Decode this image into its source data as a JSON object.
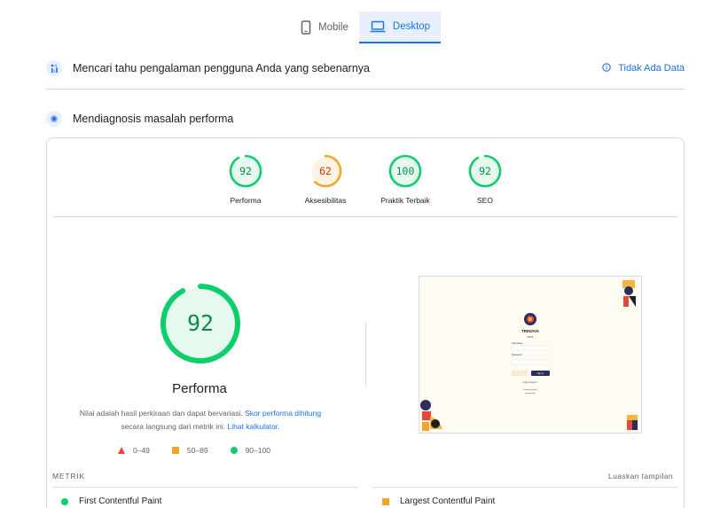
{
  "tabs": [
    {
      "label": "Mobile",
      "icon": "smartphone-icon",
      "active": false
    },
    {
      "label": "Desktop",
      "icon": "laptop-icon",
      "active": true
    }
  ],
  "field_data": {
    "title": "Mencari tahu pengalaman pengguna Anda yang sebenarnya",
    "status": "Tidak Ada Data"
  },
  "diagnose": {
    "title": "Mendiagnosis masalah performa"
  },
  "categories": [
    {
      "score": "92",
      "label": "Performa",
      "fraction": 0.92,
      "color": "#0cce6b",
      "bg": "#e6f9ee",
      "text": "#0f8a4a"
    },
    {
      "score": "62",
      "label": "Aksesibilitas",
      "fraction": 0.62,
      "color": "#f4a62a",
      "bg": "#fff4e3",
      "text": "#c33300"
    },
    {
      "score": "100",
      "label": "Praktik Terbaik",
      "fraction": 1.0,
      "color": "#0cce6b",
      "bg": "#e6f9ee",
      "text": "#0f8a4a"
    },
    {
      "score": "92",
      "label": "SEO",
      "fraction": 0.92,
      "color": "#0cce6b",
      "bg": "#e6f9ee",
      "text": "#0f8a4a"
    }
  ],
  "performance": {
    "score": "92",
    "fraction": 0.92,
    "title": "Performa",
    "desc_text": "Nilai adalah hasil perkiraan dan dapat bervariasi. ",
    "desc_link1": "Skor performa dihitung",
    "desc_text2": " secara langsung dari metrik ini. ",
    "desc_link2": "Lihat kalkulator",
    "desc_end": "."
  },
  "legend": [
    {
      "shape": "triangle",
      "label": "0–49",
      "color": "#e8453c"
    },
    {
      "shape": "square",
      "label": "50–89",
      "color": "#f4a62a"
    },
    {
      "shape": "circle",
      "label": "90–100",
      "color": "#0cce6b"
    }
  ],
  "thumbnail": {
    "brand": "TRINOVA",
    "subtitle": "2016",
    "username_label": "Username",
    "password_label": "Password",
    "button": "Sign In",
    "link": "Login Petugas ?"
  },
  "metrics": {
    "header": "METRIK",
    "expand": "Luaskan tampilan",
    "items": [
      {
        "label": "First Contentful Paint",
        "shape": "circle",
        "color": "#0cce6b"
      },
      {
        "label": "Largest Contentful Paint",
        "shape": "square",
        "color": "#f4a62a"
      }
    ]
  },
  "colors": {
    "accent": "#1a73e8",
    "pass": "#0cce6b",
    "average": "#f4a62a",
    "fail": "#e8453c"
  }
}
